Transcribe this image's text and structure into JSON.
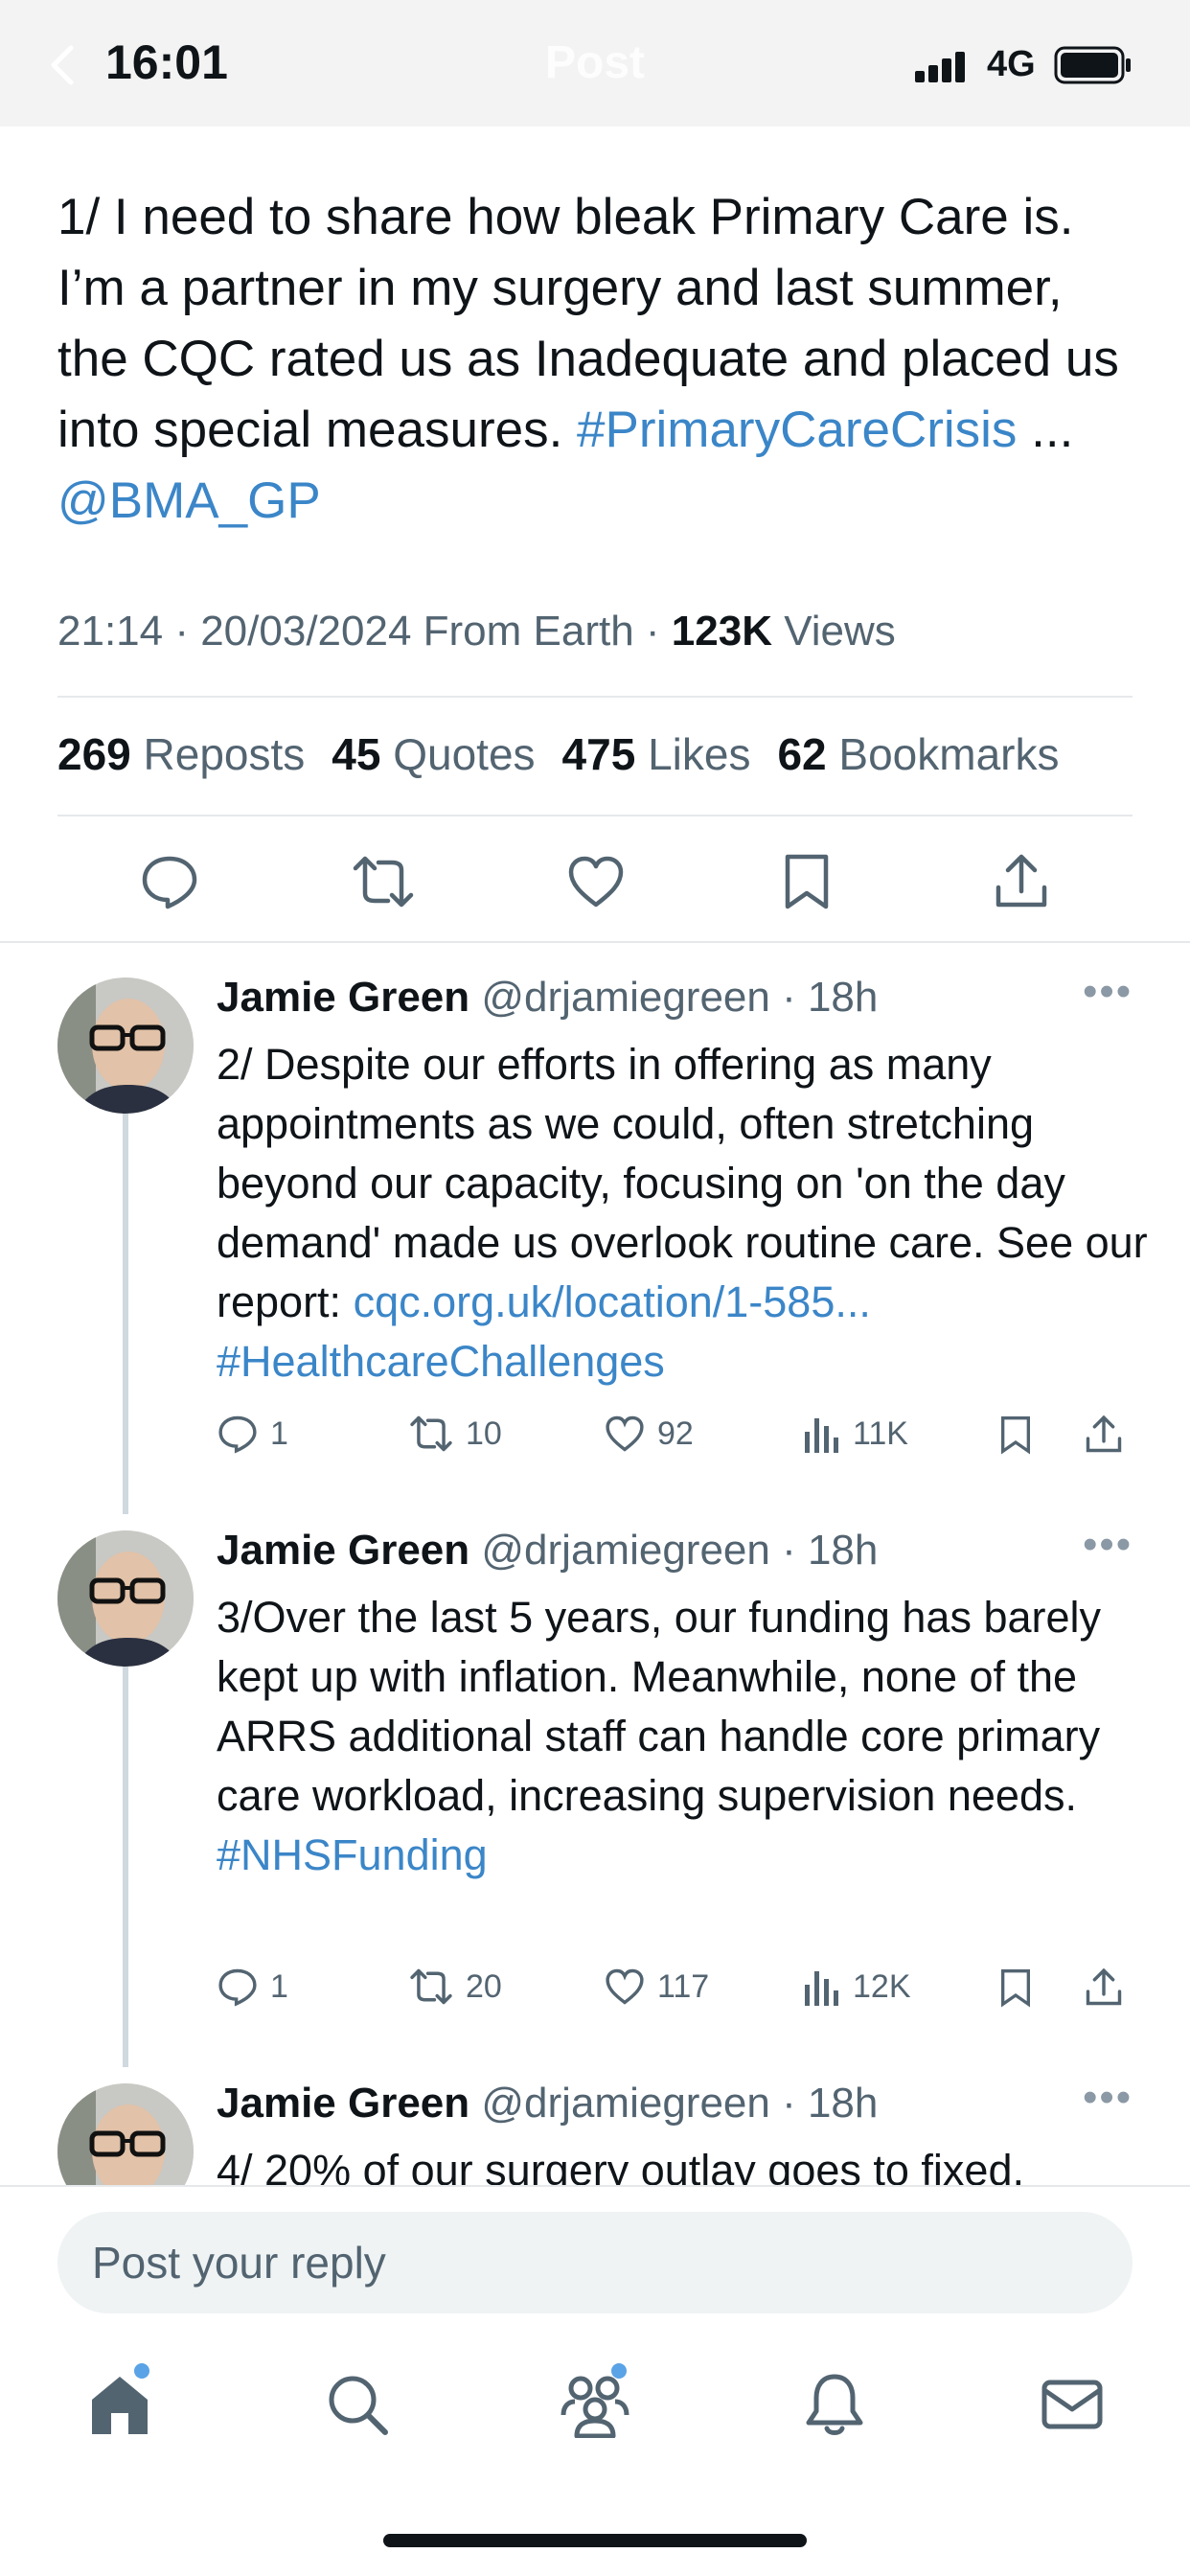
{
  "status_bar": {
    "time": "16:01",
    "network": "4G"
  },
  "header": {
    "title": "Post"
  },
  "post": {
    "text_plain": "1/ I need to share how bleak Primary Care is. I’m a partner in my surgery and last summer, the CQC rated us as Inadequate and placed us into special measures. ",
    "hashtag": "#PrimaryCareCrisis",
    "ellipsis": " ...",
    "mention": "@BMA_GP",
    "meta_time": "21:14 · 20/03/2024 From Earth · ",
    "views_count": "123K",
    "views_label": " Views",
    "stats": {
      "reposts_count": "269",
      "reposts_label": " Reposts",
      "quotes_count": "45",
      "quotes_label": " Quotes",
      "likes_count": "475",
      "likes_label": " Likes",
      "bookmarks_count": "62",
      "bookmarks_label": " Bookmarks"
    }
  },
  "replies": [
    {
      "name": "Jamie Green",
      "handle": "@drjamiegreen · 18h",
      "text": "2/ Despite our efforts in offering as many appointments as we could, often stretching beyond our capacity, focusing on 'on the day demand' made us overlook routine care. See our report: ",
      "link": "cqc.org.uk/location/1-585...",
      "hashtag": "#HealthcareChallenges",
      "replies_count": "1",
      "reposts_count": "10",
      "likes_count": "92",
      "views_count": "11K"
    },
    {
      "name": "Jamie Green",
      "handle": "@drjamiegreen · 18h",
      "text": "3/Over the last 5 years, our funding has barely kept up with inflation. Meanwhile, none of the ARRS additional staff can handle core primary care workload, increasing supervision needs.",
      "hashtag": "#NHSFunding",
      "replies_count": "1",
      "reposts_count": "20",
      "likes_count": "117",
      "views_count": "12K"
    },
    {
      "name": "Jamie Green",
      "handle": "@drjamiegreen · 18h",
      "text": "4/ 20% of our surgery outlay goes to fixed,"
    }
  ],
  "reply_bar": {
    "placeholder": "Post your reply"
  },
  "tabs": [
    "home-icon",
    "search-icon",
    "communities-icon",
    "notifications-icon",
    "messages-icon"
  ],
  "colors": {
    "link": "#3b86c8",
    "secondary_text": "#536471",
    "dot": "#5aa3e6"
  }
}
